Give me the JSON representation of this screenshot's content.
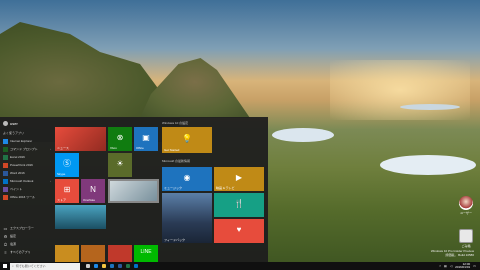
{
  "start_menu": {
    "user": "user",
    "section_most_used": "よく使うアプリ",
    "apps": [
      {
        "label": "Internet Explorer",
        "color": "#1e88e5",
        "has_arrow": false
      },
      {
        "label": "コマンド プロンプト",
        "color": "#1b5e20",
        "has_arrow": true
      },
      {
        "label": "Excel 2016",
        "color": "#217346",
        "has_arrow": false
      },
      {
        "label": "PowerPoint 2016",
        "color": "#d24726",
        "has_arrow": false
      },
      {
        "label": "Word 2016",
        "color": "#2b579a",
        "has_arrow": false
      },
      {
        "label": "Microsoft Outlook",
        "color": "#0072c6",
        "has_arrow": true
      },
      {
        "label": "ペイント",
        "color": "#6a4ea0",
        "has_arrow": false
      },
      {
        "label": "Office 2016 ツール",
        "color": "#d24726",
        "has_arrow": false
      }
    ],
    "bottom": [
      {
        "label": "エクスプローラー",
        "icon": "folder-icon",
        "glyph": "▭"
      },
      {
        "label": "設定",
        "icon": "gear-icon",
        "glyph": "⚙"
      },
      {
        "label": "電源",
        "icon": "power-icon",
        "glyph": "⏻"
      },
      {
        "label": "すべてのアプリ",
        "icon": "list-icon",
        "glyph": "≡"
      }
    ],
    "groups": {
      "left": "",
      "right_top": "Windows 10 の設定",
      "right_mid": "Microsoft の最新情報"
    },
    "tiles": {
      "news": "ニュース",
      "xbox": "Xbox",
      "office": "Office",
      "skype": "Skype",
      "store": "ストア",
      "onenote": "OneNote",
      "photos": "",
      "weather": "",
      "get_started": "Get Started",
      "groove": "ミュージック",
      "movies": "映画 & テレビ",
      "feedback": "フィードバック",
      "food": "",
      "health": "",
      "line": "LINE"
    }
  },
  "taskbar": {
    "search_placeholder": "何でも聞いてください",
    "clock_time": "12:00",
    "clock_date": "2016/01/01"
  },
  "desktop_icons": [
    {
      "label": "ユーザー"
    },
    {
      "label": "ごみ箱"
    }
  ],
  "watermark": {
    "line1": "Windows 10 Pro Insider Preview",
    "line2": "評価版。 Build 10586"
  }
}
